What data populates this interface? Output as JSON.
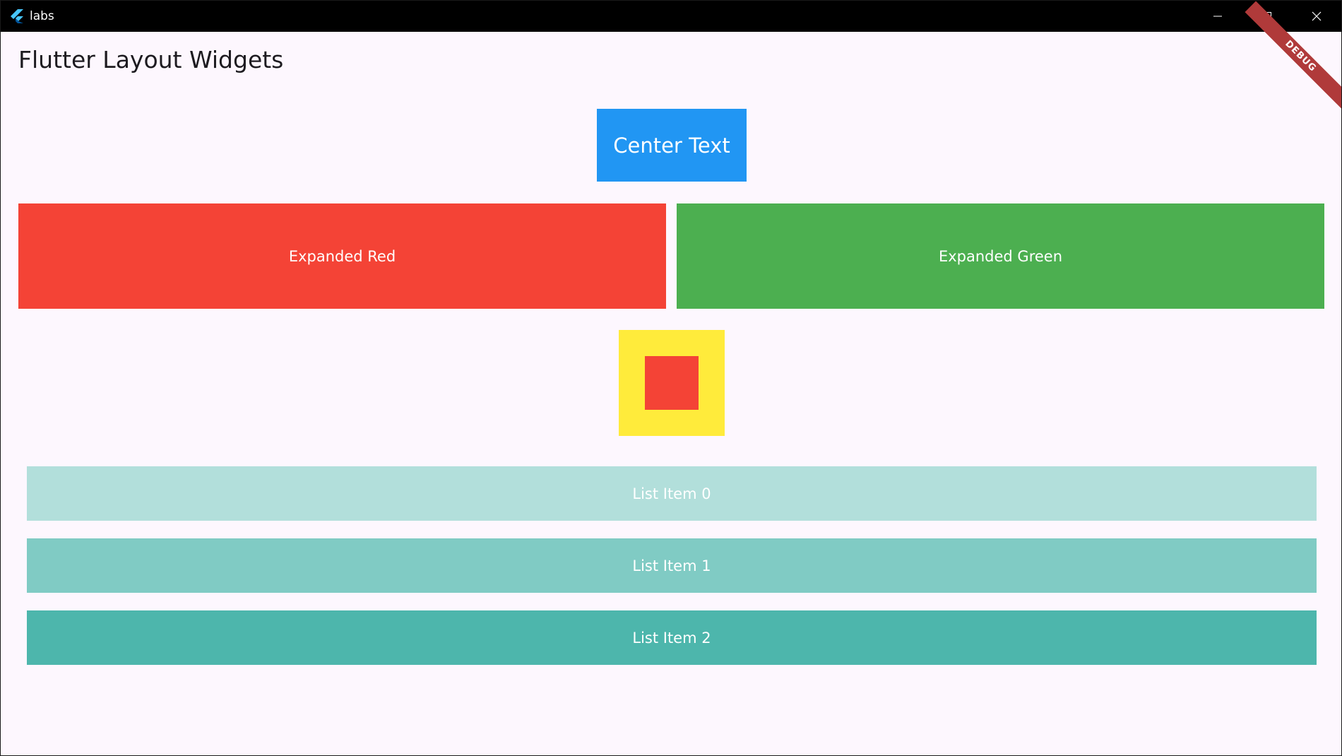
{
  "window": {
    "title": "labs",
    "icon": "flutter-logo-icon",
    "controls": {
      "minimize_icon": "minimize-icon",
      "maximize_icon": "maximize-icon",
      "close_icon": "close-icon"
    }
  },
  "debug_banner": "DEBUG",
  "appbar": {
    "title": "Flutter Layout Widgets"
  },
  "center_box": {
    "label": "Center Text",
    "color": "#2196f3"
  },
  "expanded": {
    "red": {
      "label": "Expanded Red",
      "color": "#f44336"
    },
    "green": {
      "label": "Expanded Green",
      "color": "#4caf50"
    }
  },
  "nested": {
    "outer_color": "#ffeb3b",
    "inner_color": "#f44336"
  },
  "list": {
    "items": [
      {
        "label": "List Item 0",
        "color": "#b2dfdb"
      },
      {
        "label": "List Item 1",
        "color": "#80cbc4"
      },
      {
        "label": "List Item 2",
        "color": "#4db6ac"
      }
    ]
  }
}
